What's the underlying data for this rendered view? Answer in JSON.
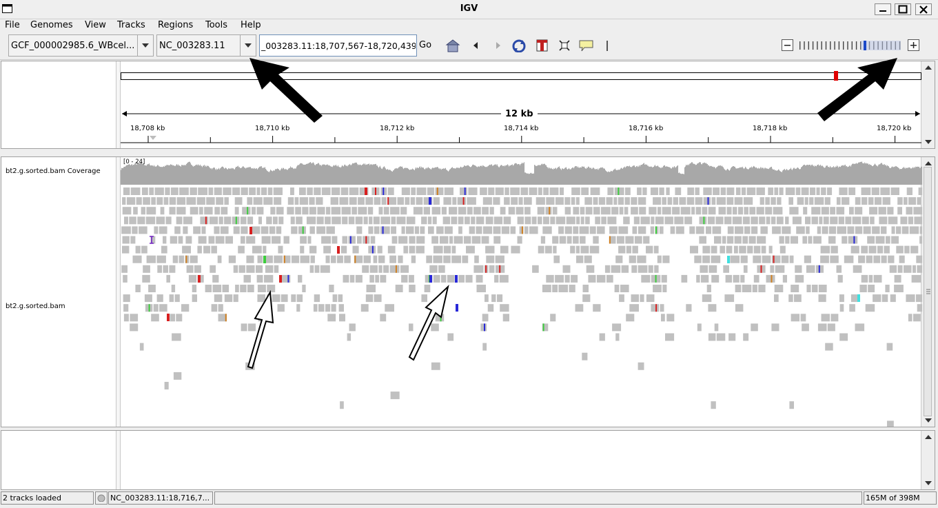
{
  "window": {
    "title": "IGV"
  },
  "menu": [
    "File",
    "Genomes",
    "View",
    "Tracks",
    "Regions",
    "Tools",
    "Help"
  ],
  "toolbar": {
    "genome": "GCF_000002985.6_WBcel...",
    "chromosome": "NC_003283.11",
    "locus": "_003283.11:18,707,567-18,720,439",
    "go_label": "Go"
  },
  "ruler": {
    "span_label": "12 kb",
    "ticks": [
      "18,708 kb",
      "18,710 kb",
      "18,712 kb",
      "18,714 kb",
      "18,716 kb",
      "18,718 kb",
      "18,720 kb"
    ]
  },
  "tracks": {
    "coverage_name": "bt2.g.sorted.bam Coverage",
    "coverage_range": "[0 - 24]",
    "alignment_name": "bt2.g.sorted.bam"
  },
  "status": {
    "tracks_loaded": "2 tracks loaded",
    "position": "NC_003283.11:18,716,7...",
    "memory": "165M of 398M"
  },
  "colors": {
    "read": "#c0c0c0",
    "coverage": "#a8a8a8",
    "mismatch_a": "#3ccc3c",
    "mismatch_c": "#2828d8",
    "mismatch_g": "#d08020",
    "mismatch_t": "#d82020",
    "cytoband_marker": "#e00000"
  }
}
